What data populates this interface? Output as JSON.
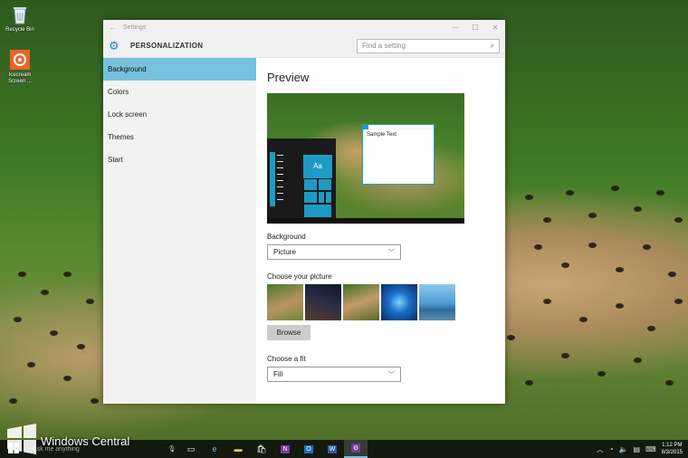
{
  "desktop": {
    "icons": [
      {
        "label": "Recycle Bin",
        "icon": "recycle-bin-icon"
      },
      {
        "label": "Icecream Screen ...",
        "icon": "icecream-recorder-icon"
      }
    ]
  },
  "window": {
    "title": "Settings",
    "section": "PERSONALIZATION",
    "search_placeholder": "Find a setting",
    "controls": [
      "minimize",
      "maximize",
      "close"
    ]
  },
  "nav": {
    "items": [
      {
        "label": "Background",
        "active": true
      },
      {
        "label": "Colors",
        "active": false
      },
      {
        "label": "Lock screen",
        "active": false
      },
      {
        "label": "Themes",
        "active": false
      },
      {
        "label": "Start",
        "active": false
      }
    ]
  },
  "content": {
    "heading": "Preview",
    "preview_sample_text": "Sample Text",
    "preview_tile_text": "Aa",
    "background_label": "Background",
    "background_value": "Picture",
    "picture_label": "Choose your picture",
    "browse_label": "Browse",
    "fit_label": "Choose a fit",
    "fit_value": "Fill"
  },
  "taskbar": {
    "search_placeholder": "Ask me anything",
    "apps": [
      "task-view",
      "edge",
      "file-explorer",
      "store",
      "onenote",
      "outlook",
      "word",
      "settings"
    ],
    "clock_time": "1:12 PM",
    "clock_date": "8/3/2015"
  },
  "watermark": "Windows Central",
  "colors": {
    "accent": "#1e9bc4",
    "nav_selected": "#76c2de"
  }
}
